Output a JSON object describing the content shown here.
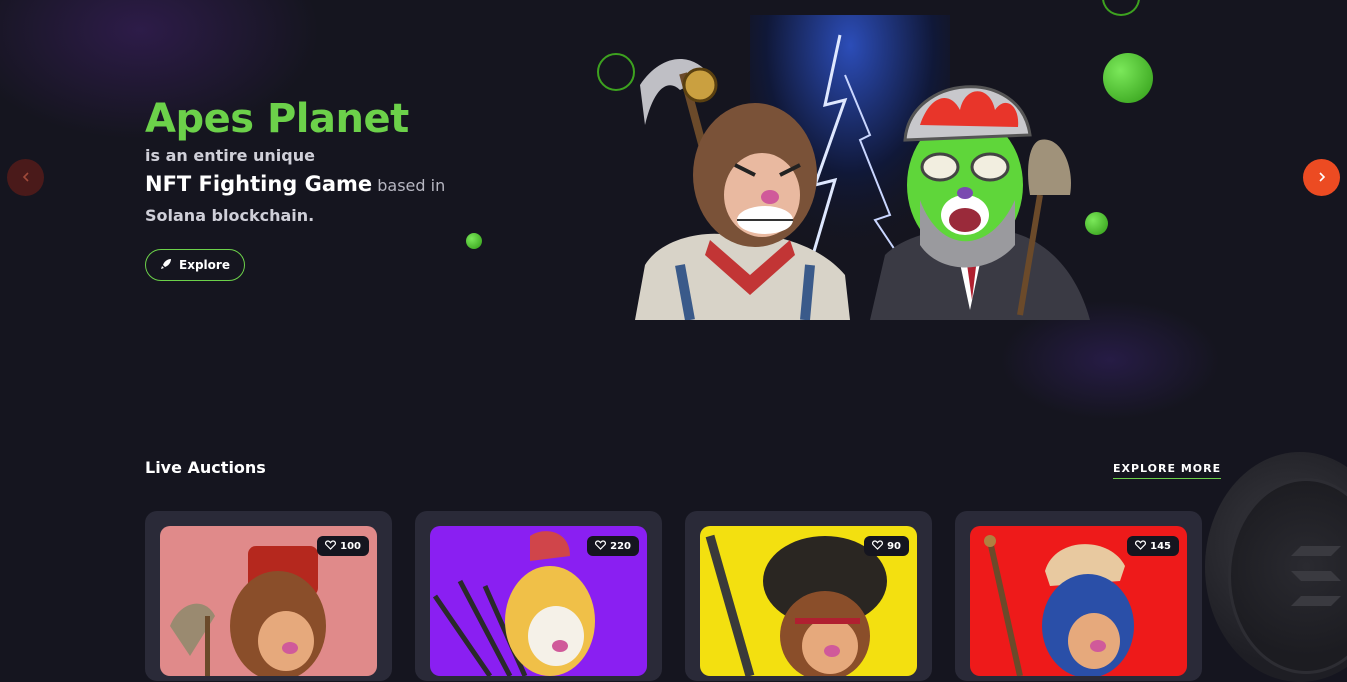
{
  "hero": {
    "title": "Apes Planet",
    "line1": "is an entire unique",
    "line2_strong": "NFT Fighting Game",
    "line2_dim": " based in",
    "line3": "Solana blockchain.",
    "explore_label": "Explore"
  },
  "carousel": {
    "prev_icon": "chevron-left-icon",
    "next_icon": "chevron-right-icon",
    "accent": "#ec4b22"
  },
  "auctions": {
    "title": "Live Auctions",
    "explore_more": "EXPLORE MORE",
    "cards": [
      {
        "likes": "100",
        "bg": "#e08a8a"
      },
      {
        "likes": "220",
        "bg": "#8a1ff2"
      },
      {
        "likes": "90",
        "bg": "#f3e010"
      },
      {
        "likes": "145",
        "bg": "#ee1a1a"
      }
    ]
  },
  "colors": {
    "accent_green": "#6cd14a",
    "background": "#15151f",
    "card": "#2a2a38"
  }
}
